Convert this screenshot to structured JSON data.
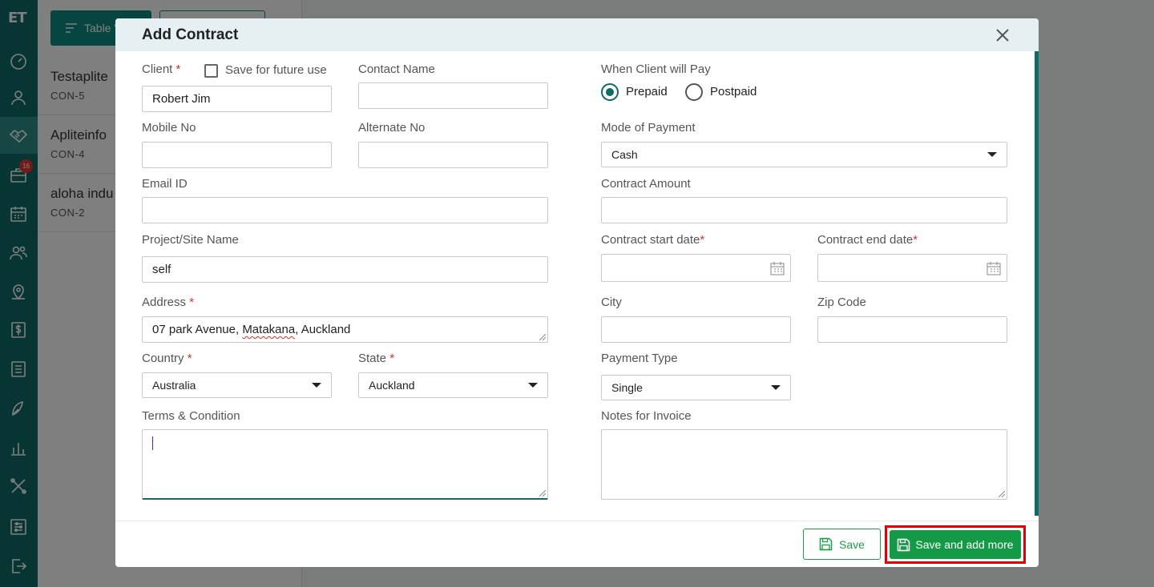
{
  "app": {
    "logo": "ET",
    "notification_count": "16"
  },
  "background": {
    "table_view_label": "Table V",
    "contracts": [
      {
        "name": "Testaplite",
        "code": "CON-5"
      },
      {
        "name": "Apliteinfo",
        "code": "CON-4"
      },
      {
        "name": "aloha indu",
        "code": "CON-2"
      }
    ]
  },
  "modal": {
    "title": "Add Contract",
    "client": {
      "label": "Client",
      "required": "*",
      "value": "Robert Jim"
    },
    "save_future": {
      "label": "Save for future use"
    },
    "contact_name": {
      "label": "Contact Name",
      "value": ""
    },
    "mobile_no": {
      "label": "Mobile No",
      "value": ""
    },
    "alternate_no": {
      "label": "Alternate No",
      "value": ""
    },
    "email": {
      "label": "Email ID",
      "value": ""
    },
    "project": {
      "label": "Project/Site Name",
      "value": "self"
    },
    "address": {
      "label": "Address",
      "required": "*",
      "value_part1": "07 park Avenue, ",
      "value_misspelled": "Matakana",
      "value_part2": ", Auckland"
    },
    "country": {
      "label": "Country",
      "required": "*",
      "value": "Australia"
    },
    "state": {
      "label": "State",
      "required": "*",
      "value": "Auckland"
    },
    "terms": {
      "label": "Terms & Condition"
    },
    "when_pay": {
      "label": "When Client will Pay",
      "options": [
        "Prepaid",
        "Postpaid"
      ],
      "selected": "Prepaid"
    },
    "mode_payment": {
      "label": "Mode of Payment",
      "value": "Cash"
    },
    "contract_amount": {
      "label": "Contract Amount",
      "value": ""
    },
    "start_date": {
      "label": "Contract start date",
      "required": "*"
    },
    "end_date": {
      "label": "Contract end date",
      "required": "*"
    },
    "city": {
      "label": "City"
    },
    "zip": {
      "label": "Zip Code"
    },
    "payment_type": {
      "label": "Payment Type",
      "value": "Single"
    },
    "notes": {
      "label": "Notes for Invoice"
    },
    "buttons": {
      "save": "Save",
      "save_more": "Save and add more"
    }
  },
  "colors": {
    "primary": "#0e6b66",
    "success": "#149a46",
    "required": "#d32f2f",
    "highlight": "#e00000"
  }
}
